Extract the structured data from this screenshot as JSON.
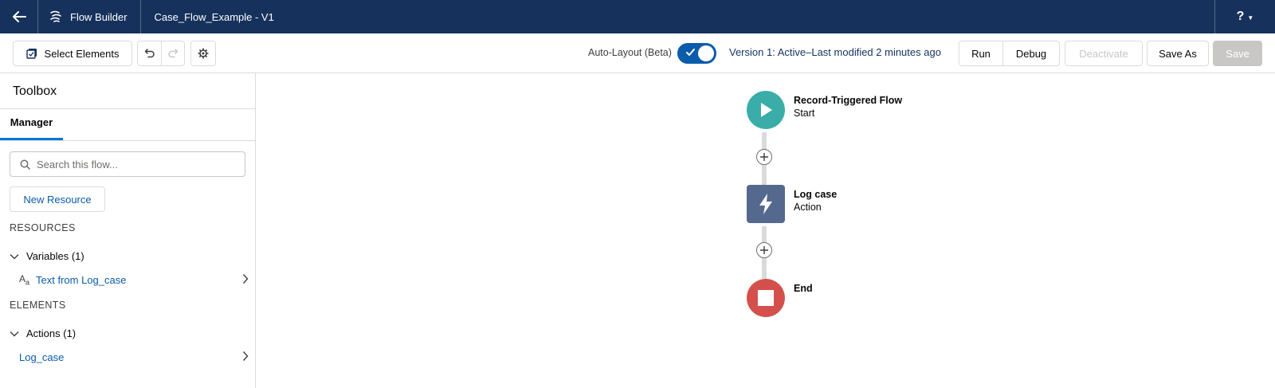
{
  "topbar": {
    "app_name": "Flow Builder",
    "flow_title": "Case_Flow_Example - V1",
    "help_label": "?"
  },
  "toolbar": {
    "select_elements_label": "Select Elements",
    "autolayout_label": "Auto-Layout (Beta)",
    "autolayout_enabled": true,
    "version_status": "Version 1: Active–Last modified 2 minutes ago",
    "run_label": "Run",
    "debug_label": "Debug",
    "deactivate_label": "Deactivate",
    "save_as_label": "Save As",
    "save_label": "Save"
  },
  "sidebar": {
    "title": "Toolbox",
    "tab_label": "Manager",
    "search_placeholder": "Search this flow...",
    "new_resource_label": "New Resource",
    "resources_heading": "RESOURCES",
    "variables_group": "Variables (1)",
    "variable_item": "Text from Log_case",
    "elements_heading": "ELEMENTS",
    "actions_group": "Actions (1)",
    "action_item": "Log_case"
  },
  "canvas": {
    "start_title": "Record-Triggered Flow",
    "start_subtitle": "Start",
    "action_title": "Log case",
    "action_subtitle": "Action",
    "end_title": "End"
  },
  "colors": {
    "header_bg": "#16325c",
    "brand_blue": "#0176d3",
    "link_blue": "#0b5cab",
    "start_node": "#3aada8",
    "action_node": "#54698d",
    "end_node": "#d4504c"
  },
  "icons": {
    "back": "back-arrow-icon",
    "app": "flow-icon",
    "select_elements": "select-elements-icon",
    "undo": "undo-icon",
    "redo": "redo-icon",
    "settings": "gear-icon",
    "search": "search-icon",
    "text_variable": "text-variable-icon",
    "start": "play-icon",
    "action": "lightning-icon",
    "end": "stop-icon"
  }
}
